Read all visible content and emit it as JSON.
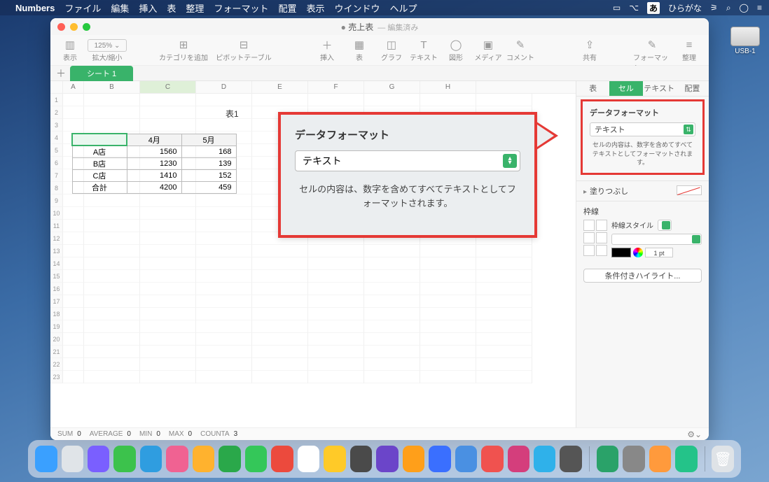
{
  "menubar": {
    "app": "Numbers",
    "items": [
      "ファイル",
      "編集",
      "挿入",
      "表",
      "整理",
      "フォーマット",
      "配置",
      "表示",
      "ウインドウ",
      "ヘルプ"
    ],
    "ime_badge": "あ",
    "ime_label": "ひらがな"
  },
  "window": {
    "title": "売上表",
    "edited": "— 編集済み",
    "toolbar": {
      "view": "表示",
      "zoom_value": "125% ⌄",
      "zoom_label": "拡大/縮小",
      "add_category": "カテゴリを追加",
      "pivot": "ピボットテーブル",
      "insert": "挿入",
      "table": "表",
      "chart": "グラフ",
      "text": "テキスト",
      "shape": "図形",
      "media": "メディア",
      "comment": "コメント",
      "share": "共有",
      "format": "フォーマット",
      "organize": "整理"
    },
    "sheet_tab": "シート 1",
    "columns": [
      "A",
      "B",
      "C",
      "D",
      "E",
      "F",
      "G",
      "H"
    ],
    "table_title": "表1",
    "table": {
      "headers": [
        "",
        "4月",
        "5月"
      ],
      "rows": [
        {
          "label": "A店",
          "m4": "1560",
          "m5": "168"
        },
        {
          "label": "B店",
          "m4": "1230",
          "m5": "139"
        },
        {
          "label": "C店",
          "m4": "1410",
          "m5": "152"
        },
        {
          "label": "合計",
          "m4": "4200",
          "m5": "459"
        }
      ]
    },
    "footer": {
      "sum_l": "SUM",
      "sum_v": "0",
      "avg_l": "AVERAGE",
      "avg_v": "0",
      "min_l": "MIN",
      "min_v": "0",
      "max_l": "MAX",
      "max_v": "0",
      "cnt_l": "COUNTA",
      "cnt_v": "3"
    }
  },
  "inspector": {
    "tabs": {
      "table": "表",
      "cell": "セル",
      "text": "テキスト",
      "arrange": "配置"
    },
    "data_format": {
      "title": "データフォーマット",
      "value": "テキスト",
      "desc": "セルの内容は、数字を含めてすべてテキストとしてフォーマットされます。"
    },
    "fill_label": "塗りつぶし",
    "border_label": "枠線",
    "border_style": "枠線スタイル",
    "pt_value": "1 pt",
    "highlight_btn": "条件付きハイライト..."
  },
  "callout": {
    "title": "データフォーマット",
    "value": "テキスト",
    "desc": "セルの内容は、数字を含めてすべてテキストとしてフォーマットされます。"
  },
  "desktop": {
    "drive": "USB-1"
  },
  "dock_colors": [
    "#3aa0ff",
    "#e0e4e8",
    "#7a5fff",
    "#3cc24c",
    "#2f9de0",
    "#f06292",
    "#ffb22e",
    "#2aa84a",
    "#34c759",
    "#ec4a3d",
    "#fff",
    "#ffca28",
    "#4a4a4a",
    "#6b45c9",
    "#ff9f1a",
    "#3a6fff",
    "#4a90e2",
    "#f0524f",
    "#d43e7c",
    "#2fb1ea",
    "#555",
    "#2aa269",
    "#888",
    "#ff9a3c",
    "#24c389"
  ]
}
